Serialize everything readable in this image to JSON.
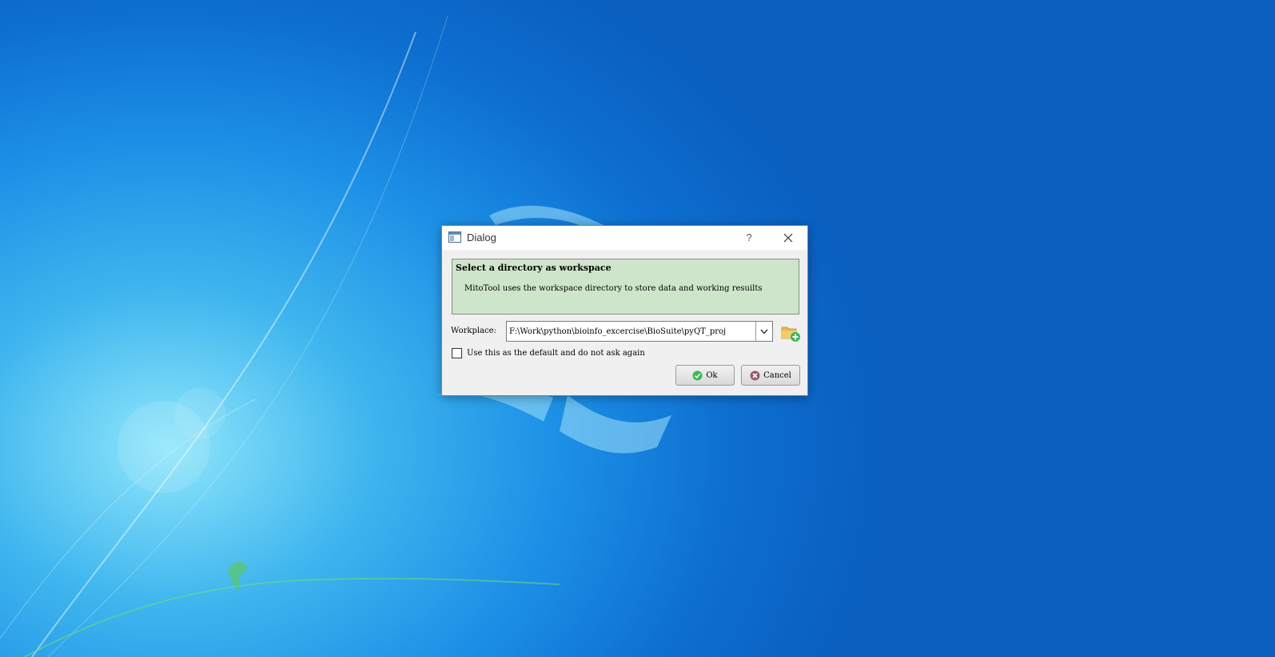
{
  "window": {
    "title": "Dialog"
  },
  "titlebar": {
    "help": "?"
  },
  "info": {
    "title": "Select a directory as workspace",
    "description": "MitoTool uses the workspace directory to store data and working resuilts"
  },
  "workspace": {
    "label": "Workplace:",
    "value": "F:\\Work\\python\\bioinfo_excercise\\BioSuite\\pyQT_proj"
  },
  "default_checkbox": {
    "label": "Use this as the default and do not ask again",
    "checked": false
  },
  "buttons": {
    "ok": "Ok",
    "cancel": "Cancel"
  },
  "colors": {
    "info_bg": "#cfe5cb",
    "ok_icon": "#3bb85a",
    "cancel_icon": "#9c5a6a"
  }
}
